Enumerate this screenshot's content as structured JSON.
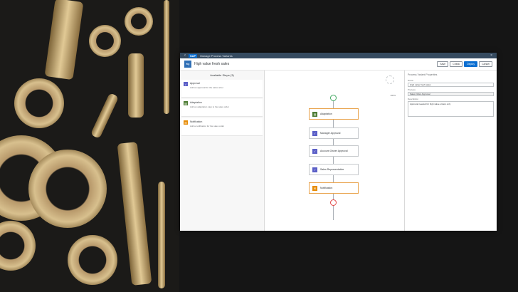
{
  "shell": {
    "app_title": "Manage Process Variants"
  },
  "header": {
    "title": "High value fresh sales",
    "buttons": [
      "Save",
      "Check",
      "Deploy",
      "Cancel"
    ]
  },
  "steps_panel": {
    "title": "Available Steps (3)",
    "steps": [
      {
        "name": "Approval",
        "desc": "Add an approval for the sales order",
        "color": "#5b5fc7",
        "glyph": "✓"
      },
      {
        "name": "Adaptation",
        "desc": "Add an adaptation step to the sales order",
        "color": "#4e7d35",
        "glyph": "▤"
      },
      {
        "name": "Notification",
        "desc": "Add a notification for the sales order",
        "color": "#e78c07",
        "glyph": "✉"
      }
    ]
  },
  "canvas": {
    "zoom_label": "100%",
    "nodes": [
      {
        "label": "Adaptation",
        "color": "#4e7d35",
        "glyph": "▤",
        "selected": true
      },
      {
        "label": "Manager Approval",
        "color": "#5b5fc7",
        "glyph": "✓",
        "selected": false
      },
      {
        "label": "Account Owner Approval",
        "color": "#5b5fc7",
        "glyph": "✓",
        "selected": false
      },
      {
        "label": "Sales Representative",
        "color": "#5b5fc7",
        "glyph": "✓",
        "selected": false
      },
      {
        "label": "Notification",
        "color": "#e78c07",
        "glyph": "✉",
        "selected": true
      }
    ]
  },
  "properties": {
    "title": "Process Variant Properties",
    "name_label": "Name",
    "name_value": "High value fresh sales",
    "process_label": "Process",
    "process_value": "Sales Order Approval",
    "desc_label": "Description",
    "desc_value": "Approval needed for high value orders only"
  },
  "colors": {
    "start": "#3fa75f",
    "end": "#e34848"
  }
}
